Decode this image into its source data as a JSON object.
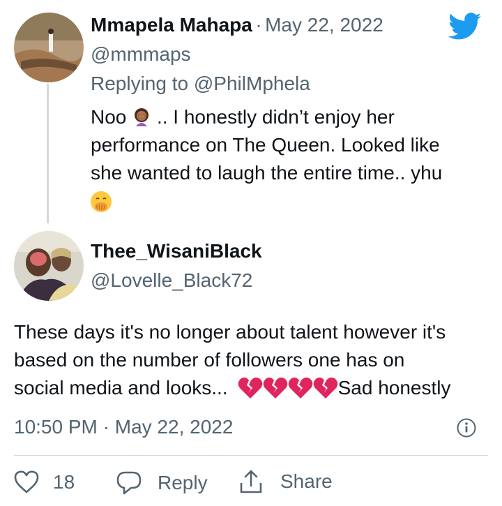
{
  "first_tweet": {
    "author_name": "Mmapela Mahapa",
    "separator": "·",
    "date": "May 22, 2022",
    "handle": "@mmmaps",
    "replying_prefix": "Replying to",
    "replying_to": "@PhilMphela",
    "text_part1": "Noo",
    "text_part2": ".. I honestly didn’t enjoy her",
    "text_line2": "performance on The Queen. Looked like",
    "text_line3": "she wanted to laugh the entire time.. yhu",
    "emojis": [
      "woman-facepalming-emoji",
      "face-with-hand-over-mouth-emoji"
    ]
  },
  "main_tweet": {
    "author_name": "Thee_WisaniBlack",
    "handle": "@Lovelle_Black72",
    "text_line1": "These days it's no longer about talent however it's",
    "text_line2": "based on the number of followers one has on",
    "text_line3_start": "social media and looks...",
    "text_line3_end": "Sad honestly",
    "emojis": [
      "broken-heart-emoji",
      "broken-heart-emoji",
      "broken-heart-emoji",
      "broken-heart-emoji"
    ],
    "time": "10:50 PM",
    "separator": "·",
    "date": "May 22, 2022"
  },
  "actions": {
    "like_count": "18",
    "reply_label": "Reply",
    "share_label": "Share"
  },
  "colors": {
    "twitter_blue": "#1d9bf0",
    "muted_text": "#536471",
    "divider": "#cfd9de",
    "broken_heart": "#e0245e"
  },
  "icons": [
    "twitter-bird-icon",
    "info-icon",
    "heart-icon",
    "reply-bubble-icon",
    "share-icon"
  ]
}
